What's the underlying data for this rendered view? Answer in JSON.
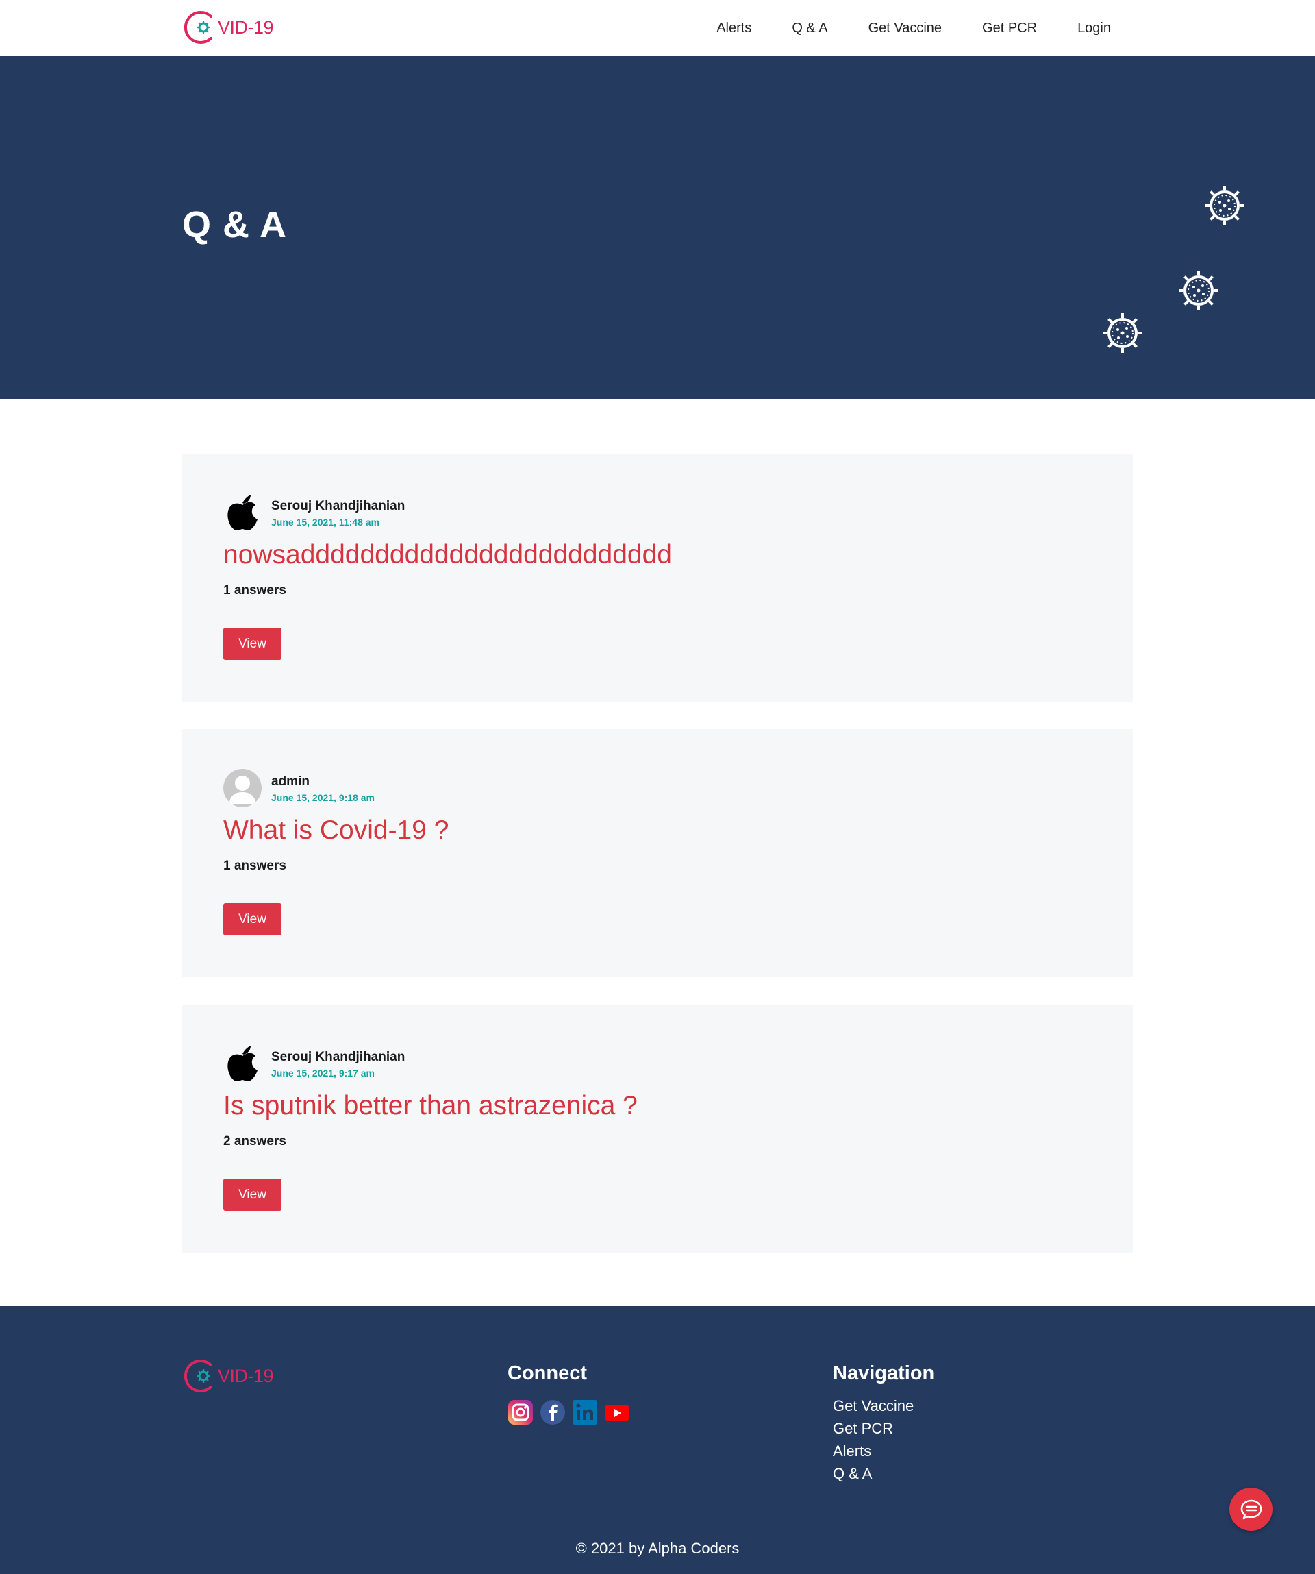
{
  "brand": {
    "logo_text": "VID-19",
    "accent": "#e0245e",
    "teal": "#17a2a2"
  },
  "nav": {
    "items": [
      {
        "label": "Alerts"
      },
      {
        "label": "Q & A"
      },
      {
        "label": "Get Vaccine"
      },
      {
        "label": "Get PCR"
      },
      {
        "label": "Login"
      }
    ]
  },
  "hero": {
    "title": "Q & A",
    "background": "#243a5e"
  },
  "questions": [
    {
      "author": "Serouj Khandjihanian",
      "avatar_icon": "apple-icon",
      "date": "June 15, 2021, 11:48 am",
      "title": "nowsaddddddddddddddddddddddddd",
      "answers": "1 answers",
      "button": "View"
    },
    {
      "author": "admin",
      "avatar_icon": "user-icon",
      "date": "June 15, 2021, 9:18 am",
      "title": "What is Covid-19 ?",
      "answers": "1 answers",
      "button": "View"
    },
    {
      "author": "Serouj Khandjihanian",
      "avatar_icon": "apple-icon",
      "date": "June 15, 2021, 9:17 am",
      "title": "Is sputnik better than astrazenica ?",
      "answers": "2 answers",
      "button": "View"
    }
  ],
  "footer": {
    "logo_text": "VID-19",
    "connect_heading": "Connect",
    "social": [
      "instagram-icon",
      "facebook-icon",
      "linkedin-icon",
      "youtube-icon"
    ],
    "navigation_heading": "Navigation",
    "links": [
      {
        "label": "Get Vaccine"
      },
      {
        "label": "Get PCR"
      },
      {
        "label": "Alerts"
      },
      {
        "label": "Q & A"
      }
    ],
    "copyright": "© 2021 by Alpha Coders"
  },
  "chat": {
    "icon": "chat-icon",
    "color": "#e33240"
  }
}
